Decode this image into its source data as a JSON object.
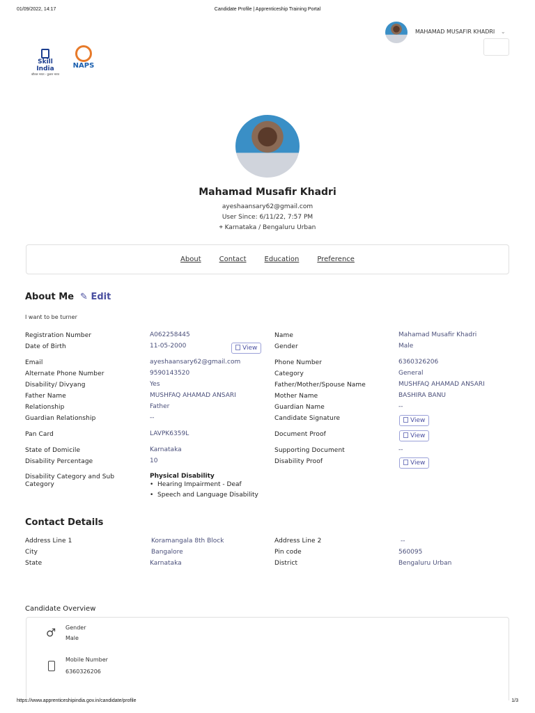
{
  "print_header": {
    "datetime": "01/09/2022, 14:17",
    "title": "Candidate Profile | Apprenticeship Training Portal"
  },
  "print_footer": {
    "url": "https://www.apprenticeshipindia.gov.in/candidate/profile",
    "page": "1/3"
  },
  "logos": {
    "skill_india": "Skill India",
    "skill_india_tagline": "कौशल भारत - कुशल भारत",
    "naps": "NAPS"
  },
  "user_menu": {
    "name": "MAHAMAD MUSAFIR KHADRI"
  },
  "profile": {
    "name": "Mahamad Musafir Khadri",
    "email": "ayeshaansary62@gmail.com",
    "user_since": "User Since: 6/11/22, 7:57 PM",
    "location": "Karnataka / Bengaluru Urban"
  },
  "tabs": [
    "About",
    "Contact",
    "Education",
    "Preference"
  ],
  "about": {
    "title": "About Me",
    "edit_label": "Edit",
    "bio": "I want to be turner",
    "view_label": "View",
    "left": [
      {
        "label": "Registration Number",
        "value": "A062258445"
      },
      {
        "label": "Date of Birth",
        "value": "11-05-2000"
      },
      {
        "label": "Email",
        "value": "ayeshaansary62@gmail.com"
      },
      {
        "label": "Alternate Phone Number",
        "value": "9590143520"
      },
      {
        "label": "Disability/ Divyang",
        "value": "Yes"
      },
      {
        "label": "Father Name",
        "value": "MUSHFAQ AHAMAD ANSARI"
      },
      {
        "label": "Relationship",
        "value": "Father"
      },
      {
        "label": "Guardian Relationship",
        "value": "--"
      },
      {
        "label": "Pan Card",
        "value": "LAVPK6359L"
      },
      {
        "label": "State of Domicile",
        "value": "Karnataka"
      },
      {
        "label": "Disability Percentage",
        "value": "10"
      },
      {
        "label": "Disability Category and Sub Category",
        "value": "Physical Disability"
      }
    ],
    "disability_sub": [
      "Hearing Impairment - Deaf",
      "Speech and Language Disability"
    ],
    "right": [
      {
        "label": "Name",
        "value": "Mahamad Musafir Khadri"
      },
      {
        "label": "Gender",
        "value": "Male"
      },
      {
        "label": "Phone Number",
        "value": "6360326206"
      },
      {
        "label": "Category",
        "value": "General"
      },
      {
        "label": "Father/Mother/Spouse Name",
        "value": "MUSHFAQ AHAMAD ANSARI"
      },
      {
        "label": "Mother Name",
        "value": "BASHIRA BANU"
      },
      {
        "label": "Guardian Name",
        "value": "--"
      },
      {
        "label": "Candidate Signature",
        "value": "View"
      },
      {
        "label": "Document Proof",
        "value": "View"
      },
      {
        "label": "Supporting Document",
        "value": "--"
      },
      {
        "label": "Disability Proof",
        "value": "View"
      }
    ]
  },
  "contact": {
    "title": "Contact Details",
    "rows": [
      {
        "label": "Address Line 1",
        "value": "Koramangala 8th Block"
      },
      {
        "label": "City",
        "value": "Bangalore"
      },
      {
        "label": "State",
        "value": "Karnataka"
      },
      {
        "label": "Address Line 2",
        "value": "--"
      },
      {
        "label": "Pin code",
        "value": "560095"
      },
      {
        "label": "District",
        "value": "Bengaluru Urban"
      }
    ]
  },
  "overview": {
    "title": "Candidate Overview",
    "items": [
      {
        "label": "Gender",
        "value": "Male",
        "icon": "male-icon"
      },
      {
        "label": "Mobile Number",
        "value": "6360326206",
        "icon": "mobile-icon"
      }
    ]
  }
}
